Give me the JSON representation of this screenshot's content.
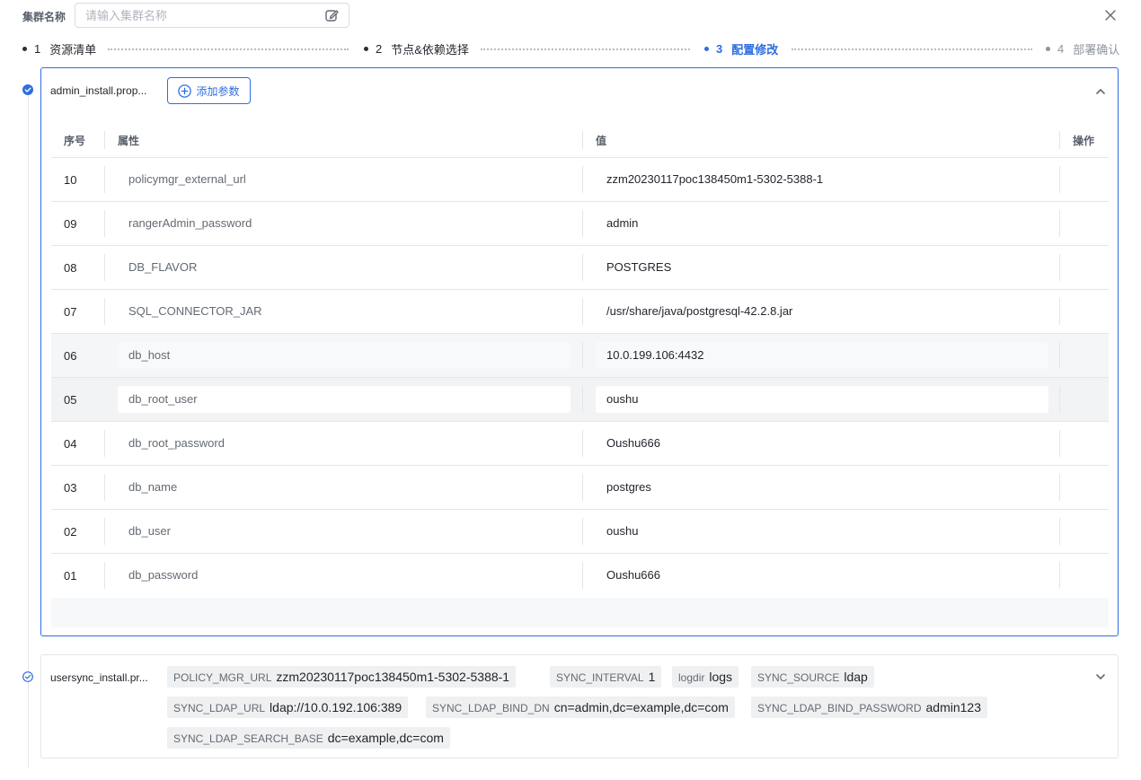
{
  "header": {
    "cluster_label": "集群名称",
    "cluster_placeholder": "请输入集群名称"
  },
  "steps": [
    {
      "num": "1",
      "label": "资源清单",
      "state": "done"
    },
    {
      "num": "2",
      "label": "节点&依赖选择",
      "state": "done"
    },
    {
      "num": "3",
      "label": "配置修改",
      "state": "active"
    },
    {
      "num": "4",
      "label": "部署确认",
      "state": "todo"
    }
  ],
  "panel1": {
    "file_name": "admin_install.prop...",
    "add_button": "添加参数",
    "columns": {
      "index": "序号",
      "property": "属性",
      "value": "值",
      "action": "操作"
    },
    "rows": [
      {
        "index": "10",
        "key": "policymgr_external_url",
        "value": "zzm20230117poc138450m1-5302-5388-1"
      },
      {
        "index": "09",
        "key": "rangerAdmin_password",
        "value": "admin"
      },
      {
        "index": "08",
        "key": "DB_FLAVOR",
        "value": "POSTGRES"
      },
      {
        "index": "07",
        "key": "SQL_CONNECTOR_JAR",
        "value": "/usr/share/java/postgresql-42.2.8.jar"
      },
      {
        "index": "06",
        "key": "db_host",
        "value": "10.0.199.106:4432"
      },
      {
        "index": "05",
        "key": "db_root_user",
        "value": "oushu"
      },
      {
        "index": "04",
        "key": "db_root_password",
        "value": "Oushu666"
      },
      {
        "index": "03",
        "key": "db_name",
        "value": "postgres"
      },
      {
        "index": "02",
        "key": "db_user",
        "value": "oushu"
      },
      {
        "index": "01",
        "key": "db_password",
        "value": "Oushu666"
      }
    ]
  },
  "panel2": {
    "file_name": "usersync_install.pr...",
    "tags": [
      {
        "key": "POLICY_MGR_URL",
        "value": "zzm20230117poc138450m1-5302-5388-1"
      },
      {
        "key": "SYNC_INTERVAL",
        "value": "1"
      },
      {
        "key": "logdir",
        "value": "logs"
      },
      {
        "key": "SYNC_SOURCE",
        "value": "ldap"
      },
      {
        "key": "SYNC_LDAP_URL",
        "value": "ldap://10.0.192.106:389"
      },
      {
        "key": "SYNC_LDAP_BIND_DN",
        "value": "cn=admin,dc=example,dc=com"
      },
      {
        "key": "SYNC_LDAP_BIND_PASSWORD",
        "value": "admin123"
      },
      {
        "key": "SYNC_LDAP_SEARCH_BASE",
        "value": "dc=example,dc=com"
      }
    ]
  },
  "colors": {
    "accent": "#2f6de1",
    "border": "#e4e6ea",
    "tag_bg": "#eff0f1"
  },
  "icons": [
    "edit-icon",
    "close-icon",
    "check-circle-icon",
    "plus-circle-icon",
    "chevron-up-icon",
    "chevron-down-icon"
  ]
}
